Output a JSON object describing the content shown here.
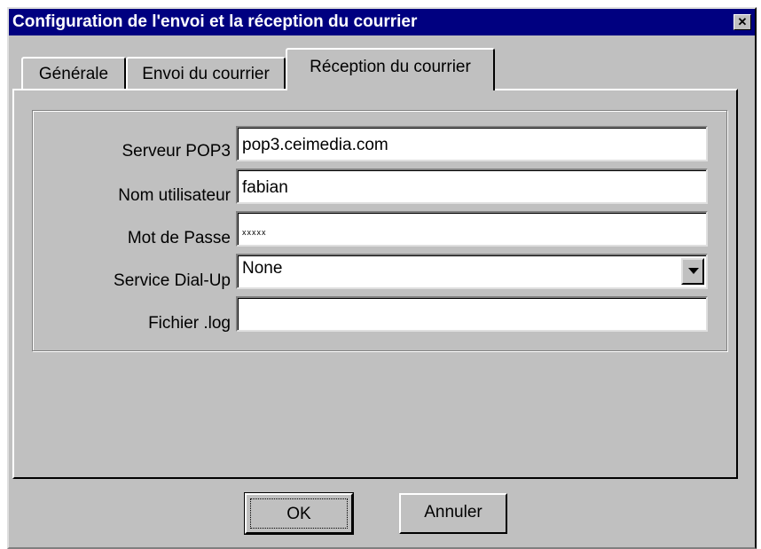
{
  "window": {
    "title": "Configuration de l'envoi et la réception du courrier",
    "close_symbol": "✕"
  },
  "tabs": [
    {
      "label": "Générale"
    },
    {
      "label": "Envoi du courrier"
    },
    {
      "label": "Réception du courrier",
      "active": true
    }
  ],
  "form": {
    "pop3": {
      "label": "Serveur POP3",
      "value": "pop3.ceimedia.com"
    },
    "user": {
      "label": "Nom utilisateur",
      "value": "fabian"
    },
    "password": {
      "label": "Mot de Passe",
      "value": "xxxxx"
    },
    "dialup": {
      "label": "Service Dial-Up",
      "value": "None"
    },
    "logfile": {
      "label": "Fichier .log",
      "value": ""
    }
  },
  "buttons": {
    "ok": "OK",
    "cancel": "Annuler"
  },
  "colors": {
    "titlebar": "#000080",
    "face": "#c0c0c0"
  }
}
